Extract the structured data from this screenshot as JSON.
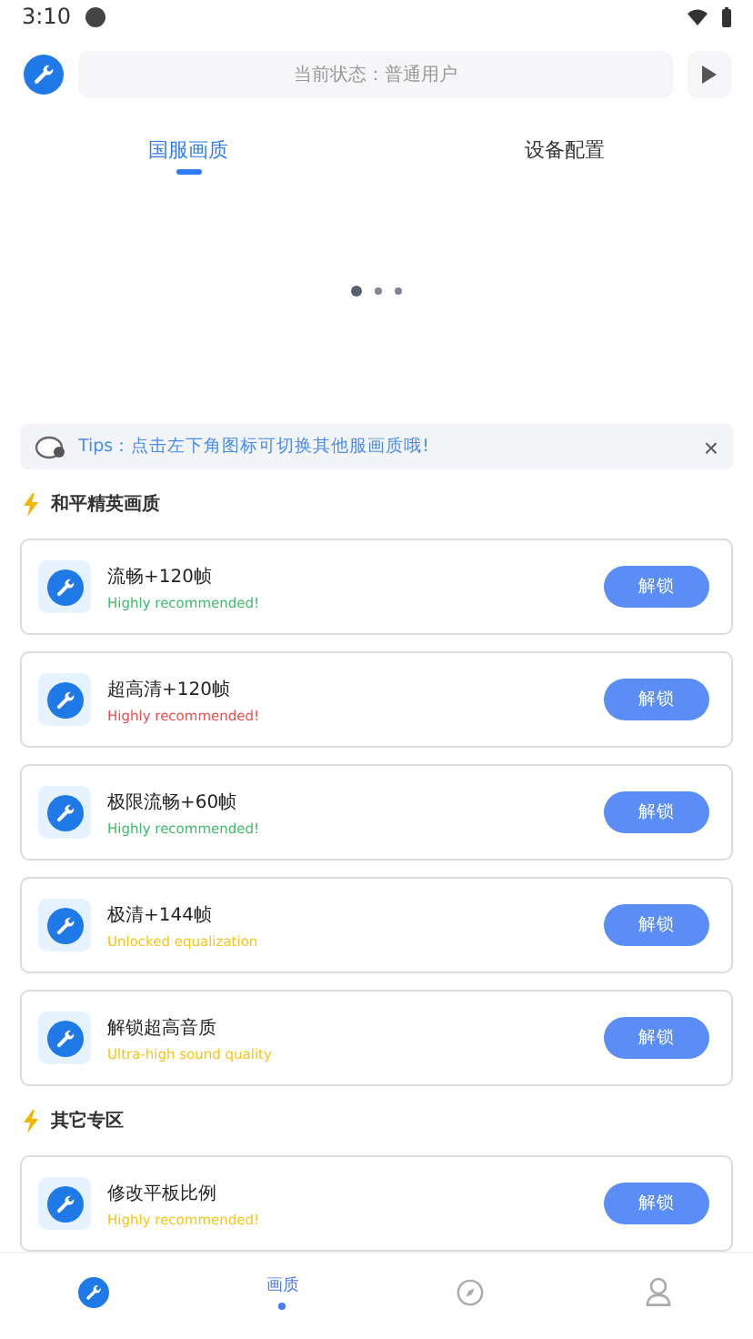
{
  "status_bar": {
    "time": "3:10"
  },
  "header": {
    "status_text": "当前状态：普通用户"
  },
  "tabs": [
    {
      "label": "国服画质",
      "selected": true
    },
    {
      "label": "设备配置",
      "selected": false
    }
  ],
  "carousel_dots": [
    {
      "selected": true
    },
    {
      "selected": false
    },
    {
      "selected": false
    }
  ],
  "tips": {
    "text": "Tips：点击左下角图标可切换其他服画质哦!",
    "close": "×"
  },
  "sections": [
    {
      "title": "和平精英画质",
      "items": [
        {
          "title": "流畅+120帧",
          "subtitle": "Highly recommended!",
          "color": "#3dbb6a",
          "button": "解锁"
        },
        {
          "title": "超高清+120帧",
          "subtitle": "Highly recommended!",
          "color": "#f04a4a",
          "button": "解锁"
        },
        {
          "title": "极限流畅+60帧",
          "subtitle": "Highly recommended!",
          "color": "#3dbb6a",
          "button": "解锁"
        },
        {
          "title": "极清+144帧",
          "subtitle": "Unlocked equalization",
          "color": "#f5c518",
          "button": "解锁"
        },
        {
          "title": "解锁超高音质",
          "subtitle": "Ultra-high sound quality",
          "color": "#f5c518",
          "button": "解锁"
        }
      ]
    },
    {
      "title": "其它专区",
      "items": [
        {
          "title": "修改平板比例",
          "subtitle": "Highly recommended!",
          "color": "#f5c518",
          "button": "解锁"
        }
      ]
    }
  ],
  "bottom_nav": [
    {
      "kind": "logo",
      "selected": false
    },
    {
      "kind": "label",
      "label": "画质",
      "selected": true
    },
    {
      "kind": "compass",
      "selected": false
    },
    {
      "kind": "user",
      "selected": false
    }
  ]
}
